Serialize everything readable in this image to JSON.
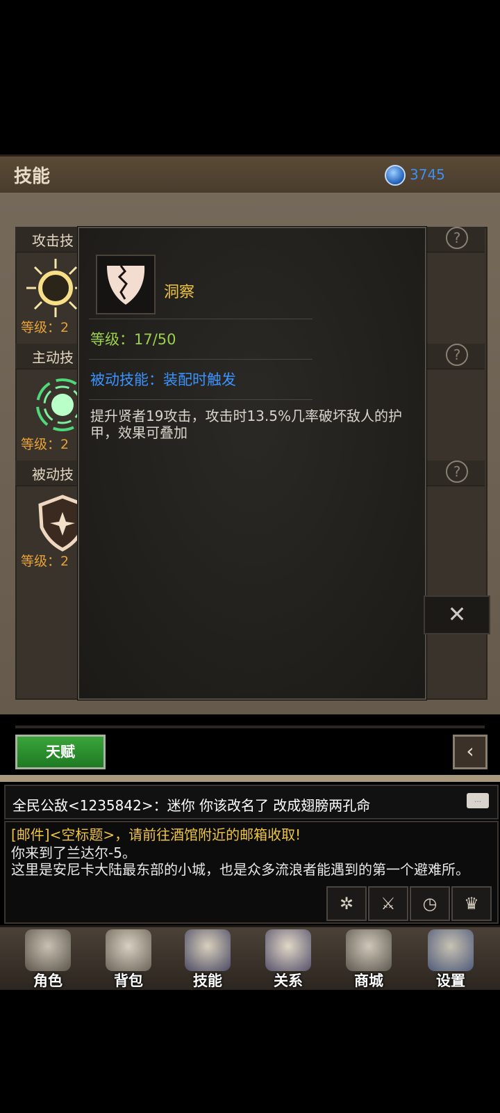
{
  "header": {
    "title": "技能",
    "currency_value": "3745",
    "currency_icon": "blue-gem-icon"
  },
  "categories": [
    {
      "label": "攻击技",
      "level": "等级：2",
      "icon": "sun-burst-icon"
    },
    {
      "label": "主动技",
      "level": "等级：2",
      "icon": "swirl-orb-icon"
    },
    {
      "label": "被动技",
      "level": "等级：2",
      "icon": "star-shield-icon"
    }
  ],
  "help_label": "?",
  "popup": {
    "icon": "cracked-shield-icon",
    "name": "洞察",
    "level": "等级：17/50",
    "type": "被动技能：装配时触发",
    "description": "提升贤者19攻击，攻击时13.5%几率破坏敌人的护甲，效果可叠加"
  },
  "close_label": "✕",
  "talent_button": "天赋",
  "back_icon": "chevron-left-icon",
  "chat": {
    "broadcast": "全民公敌<1235842>：迷你  你该改名了 改成翅膀两孔命",
    "mail_notice": "[邮件]<空标题>，请前往酒馆附近的邮箱收取!",
    "system_lines": [
      "你来到了兰达尔-5。",
      "这里是安尼卡大陆最东部的小城，也是众多流浪者能遇到的第一个避难所。"
    ],
    "tool_icons": [
      "gear-cross-icon",
      "sword-icon",
      "clock-icon",
      "trophy-icon"
    ]
  },
  "nav": [
    {
      "label": "角色",
      "icon": "helmet-icon"
    },
    {
      "label": "背包",
      "icon": "skull-backpack-icon"
    },
    {
      "label": "技能",
      "icon": "spellbook-icon"
    },
    {
      "label": "关系",
      "icon": "gauntlets-icon"
    },
    {
      "label": "商城",
      "icon": "treasure-chest-icon"
    },
    {
      "label": "设置",
      "icon": "gears-icon"
    }
  ]
}
